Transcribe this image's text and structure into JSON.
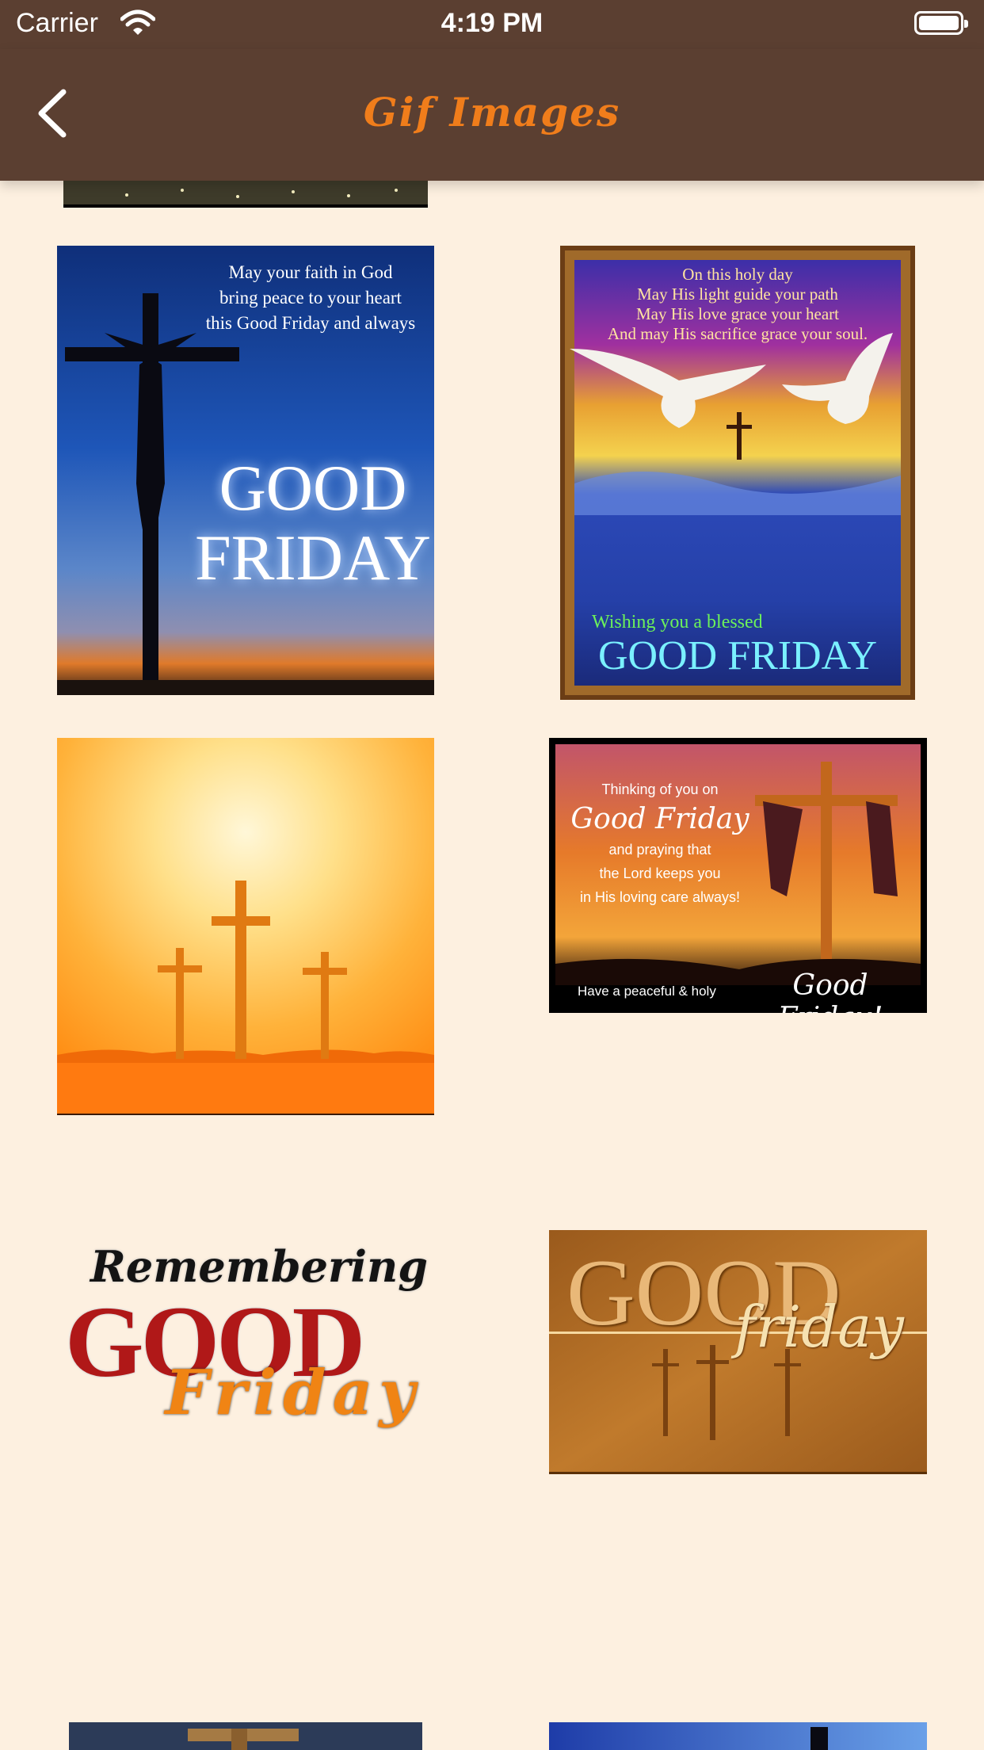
{
  "status_bar": {
    "carrier": "Carrier",
    "time": "4:19 PM"
  },
  "nav": {
    "title": "Gif Images",
    "back_icon": "chevron-left-icon"
  },
  "colors": {
    "nav_background": "#5b3f31",
    "title": "#f07d1b",
    "page_background": "#fdf0e0"
  },
  "images": {
    "img1": {
      "line1": "May your faith in God",
      "line2": "bring peace to your heart",
      "line3": "this Good Friday and always",
      "big1": "GOOD",
      "big2": "FRIDAY"
    },
    "img2": {
      "line1": "On this holy day",
      "line2": "May His light guide your path",
      "line3": "May His love grace your heart",
      "line4": "And may His sacrifice grace your soul.",
      "wish": "Wishing you a blessed",
      "big": "GOOD FRIDAY"
    },
    "img4": {
      "line1": "Thinking of you on",
      "script1": "Good Friday",
      "line2": "and praying that",
      "line3": "the Lord keeps you",
      "line4": "in His loving care always!",
      "footer1": "Have a peaceful & holy",
      "footer2": "Good Friday!"
    },
    "img5": {
      "top": "Remembering",
      "big": "GOOD",
      "script": "Friday"
    },
    "img6": {
      "big": "GOOD",
      "script": "friday"
    }
  }
}
